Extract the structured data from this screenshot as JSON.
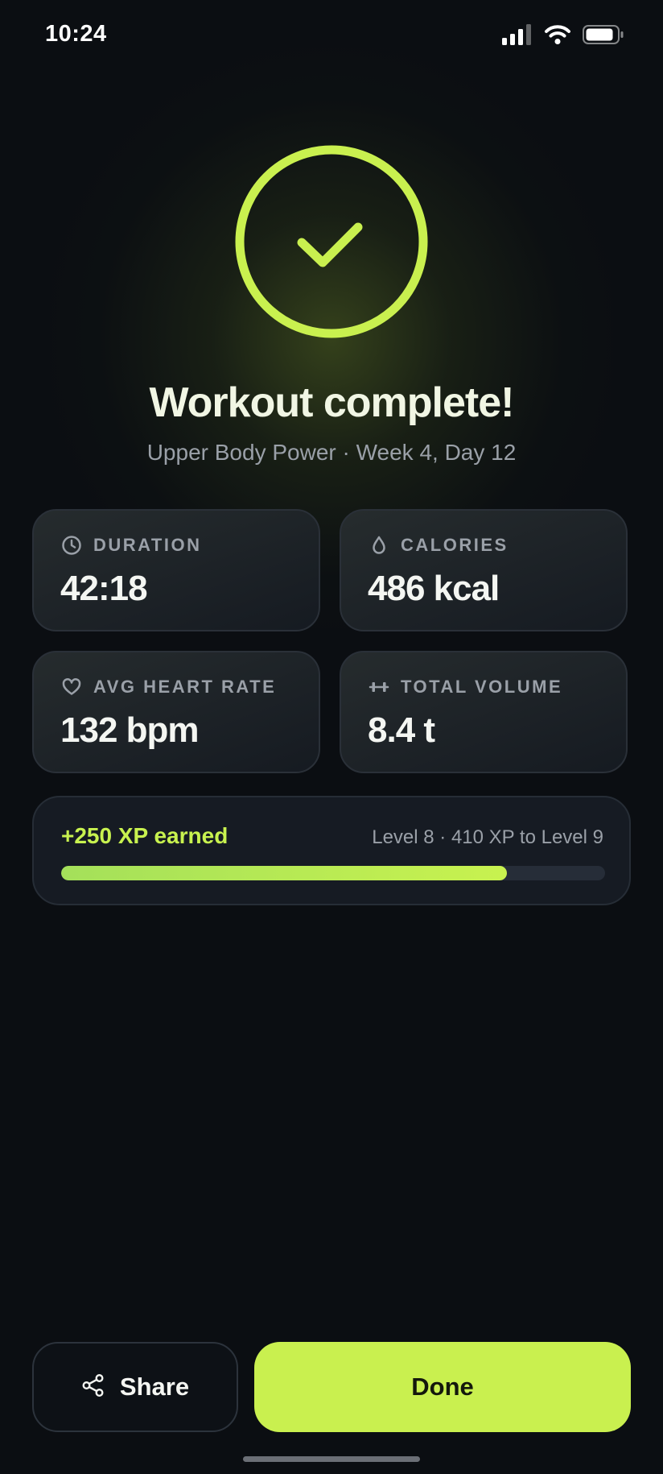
{
  "status_bar": {
    "time": "10:24",
    "icons": [
      "cellular-signal-icon",
      "wifi-icon",
      "battery-icon"
    ]
  },
  "hero": {
    "icon": "checkmark-circle-icon",
    "title": "Workout complete!",
    "subtitle": "Upper Body Power · Week 4, Day 12"
  },
  "stats": [
    {
      "icon": "clock-icon",
      "label": "DURATION",
      "value": "42:18"
    },
    {
      "icon": "flame-drop-icon",
      "label": "CALORIES",
      "value": "486 kcal"
    },
    {
      "icon": "heart-icon",
      "label": "AVG HEART RATE",
      "value": "132 bpm"
    },
    {
      "icon": "dumbbell-icon",
      "label": "TOTAL VOLUME",
      "value": "8.4 t"
    }
  ],
  "xp": {
    "earned": "+250 XP earned",
    "level_text": "Level 8 · 410 XP to Level 9",
    "progress_fraction": 0.82
  },
  "actions": {
    "share_label": "Share",
    "share_icon": "share-icon",
    "done_label": "Done"
  },
  "colors": {
    "accent": "#c9f04f",
    "background": "#0b0e12",
    "card": "#161b23",
    "muted_text": "#9aa0a8"
  }
}
